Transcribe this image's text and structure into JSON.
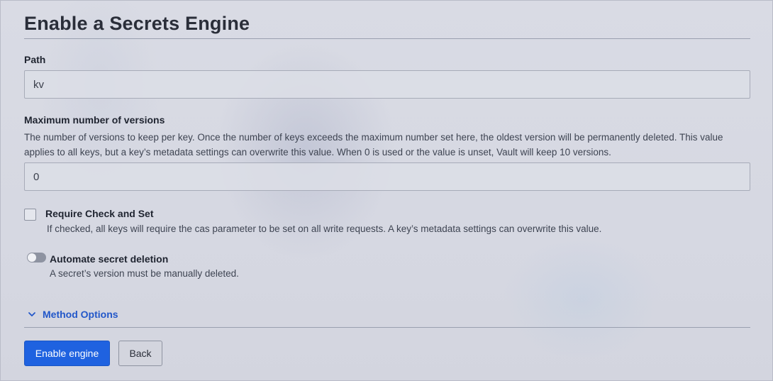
{
  "page": {
    "title": "Enable a Secrets Engine"
  },
  "path_field": {
    "label": "Path",
    "value": "kv"
  },
  "max_versions_field": {
    "label": "Maximum number of versions",
    "help": "The number of versions to keep per key. Once the number of keys exceeds the maximum number set here, the oldest version will be permanently deleted. This value applies to all keys, but a key’s metadata settings can overwrite this value. When 0 is used or the value is unset, Vault will keep 10 versions.",
    "value": "0"
  },
  "cas_option": {
    "label": "Require Check and Set",
    "help": "If checked, all keys will require the cas parameter to be set on all write requests. A key’s metadata settings can overwrite this value.",
    "checked": false
  },
  "auto_delete_option": {
    "label": "Automate secret deletion",
    "help": "A secret’s version must be manually deleted.",
    "enabled": false
  },
  "method_options": {
    "label": "Method Options",
    "icon": "chevron-down-icon",
    "expanded": false
  },
  "actions": {
    "enable_label": "Enable engine",
    "back_label": "Back"
  },
  "colors": {
    "primary": "#1f62e0",
    "link": "#2257c9"
  }
}
